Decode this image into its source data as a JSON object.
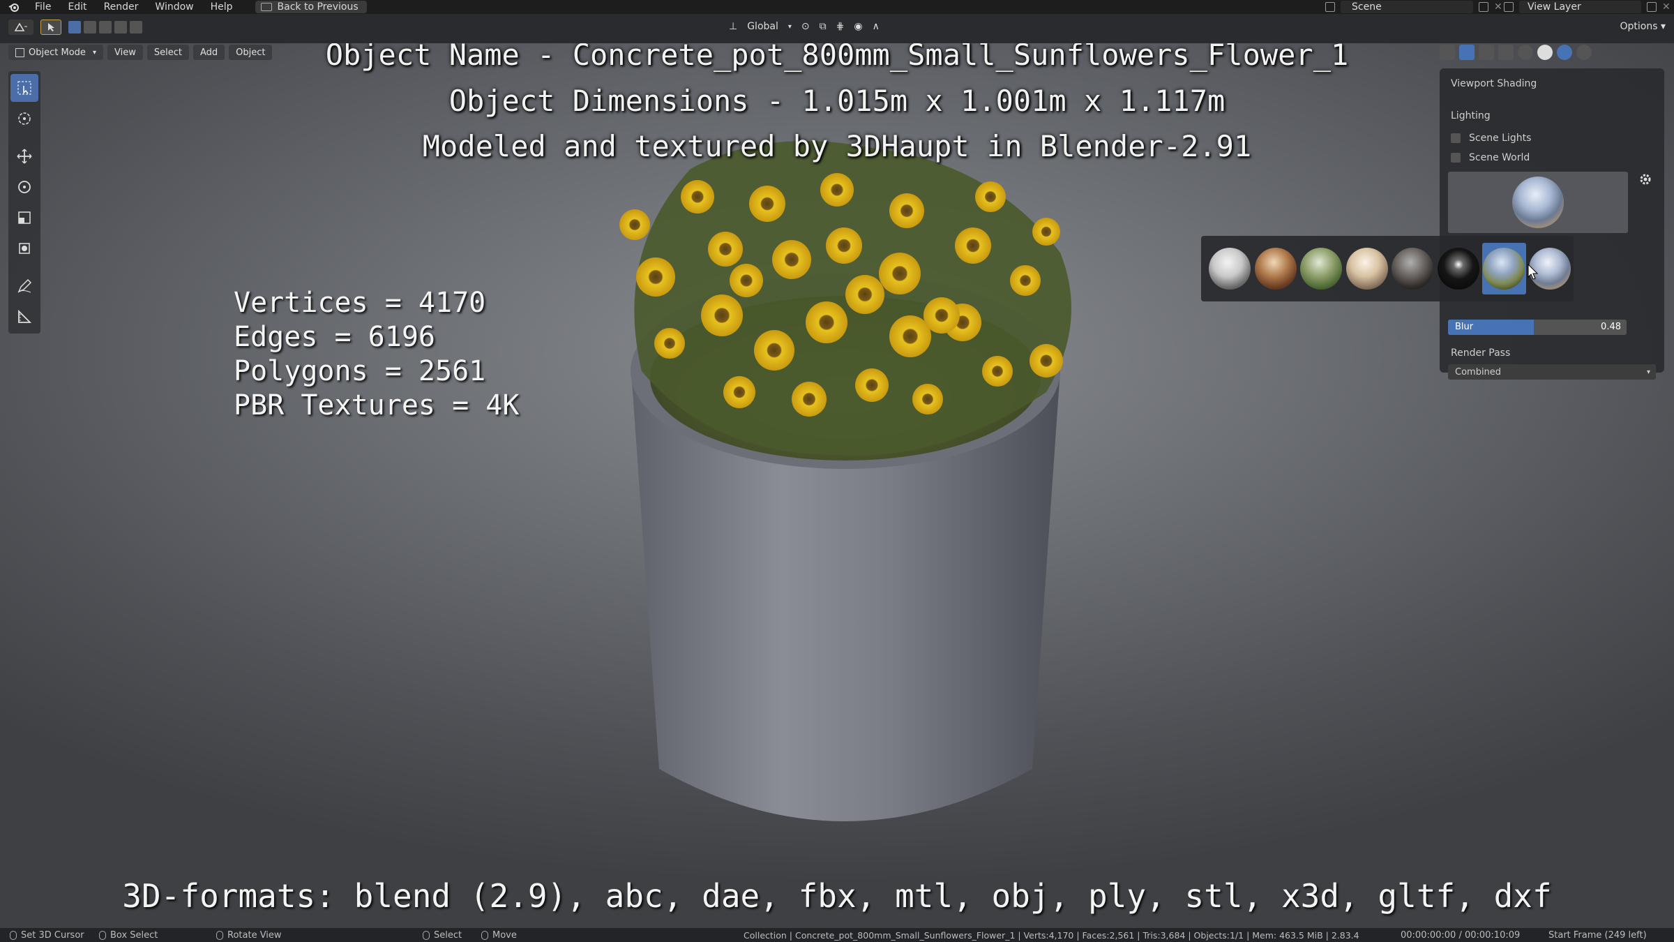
{
  "menu": {
    "items": [
      "File",
      "Edit",
      "Render",
      "Window",
      "Help"
    ],
    "back_button": "Back to Previous"
  },
  "scene": {
    "label": "Scene",
    "view_layer": "View Layer"
  },
  "header": {
    "transform_orientation": "Global",
    "options": "Options"
  },
  "viewport_header": {
    "mode": "Object Mode",
    "view": "View",
    "select": "Select",
    "add": "Add",
    "object": "Object"
  },
  "overlay": {
    "line1": "Object Name - Concrete_pot_800mm_Small_Sunflowers_Flower_1",
    "line2": "Object Dimensions -  1.015m x 1.001m x 1.117m",
    "line3": "Modeled and textured by 3DHaupt in Blender-2.91",
    "vertices": "Vertices = 4170",
    "edges": "Edges = 6196",
    "polygons": "Polygons = 2561",
    "textures": "PBR Textures = 4K",
    "formats": "3D-formats: blend (2.9), abc, dae, fbx, mtl, obj, ply, stl, x3d, gltf, dxf"
  },
  "shading_panel": {
    "title": "Viewport Shading",
    "lighting": "Lighting",
    "scene_lights": "Scene Lights",
    "scene_world": "Scene World",
    "blur_label": "Blur",
    "blur_value": "0.48",
    "blur_fraction": 0.48,
    "render_pass_label": "Render Pass",
    "render_pass_value": "Combined"
  },
  "hdri_options": [
    {
      "name": "city",
      "selected": false
    },
    {
      "name": "courtyard",
      "selected": false
    },
    {
      "name": "forest",
      "selected": false
    },
    {
      "name": "interior",
      "selected": false
    },
    {
      "name": "night",
      "selected": false
    },
    {
      "name": "studio",
      "selected": false
    },
    {
      "name": "sunflowers",
      "selected": true
    },
    {
      "name": "sunrise",
      "selected": false
    }
  ],
  "statusbar": {
    "set_cursor": "Set 3D Cursor",
    "box_select": "Box Select",
    "rotate_view": "Rotate View",
    "select": "Select",
    "move": "Move",
    "info": "Collection | Concrete_pot_800mm_Small_Sunflowers_Flower_1 | Verts:4,170 | Faces:2,561 | Tris:3,684 | Objects:1/1 | Mem: 463.5 MiB | 2.83.4",
    "time": "00:00:00:00 / 00:00:10:09",
    "start_frame": "Start Frame (249 left)"
  },
  "colors": {
    "accent": "#4772b3",
    "pot": "#7d7f8a",
    "petal": "#e2b81c"
  }
}
